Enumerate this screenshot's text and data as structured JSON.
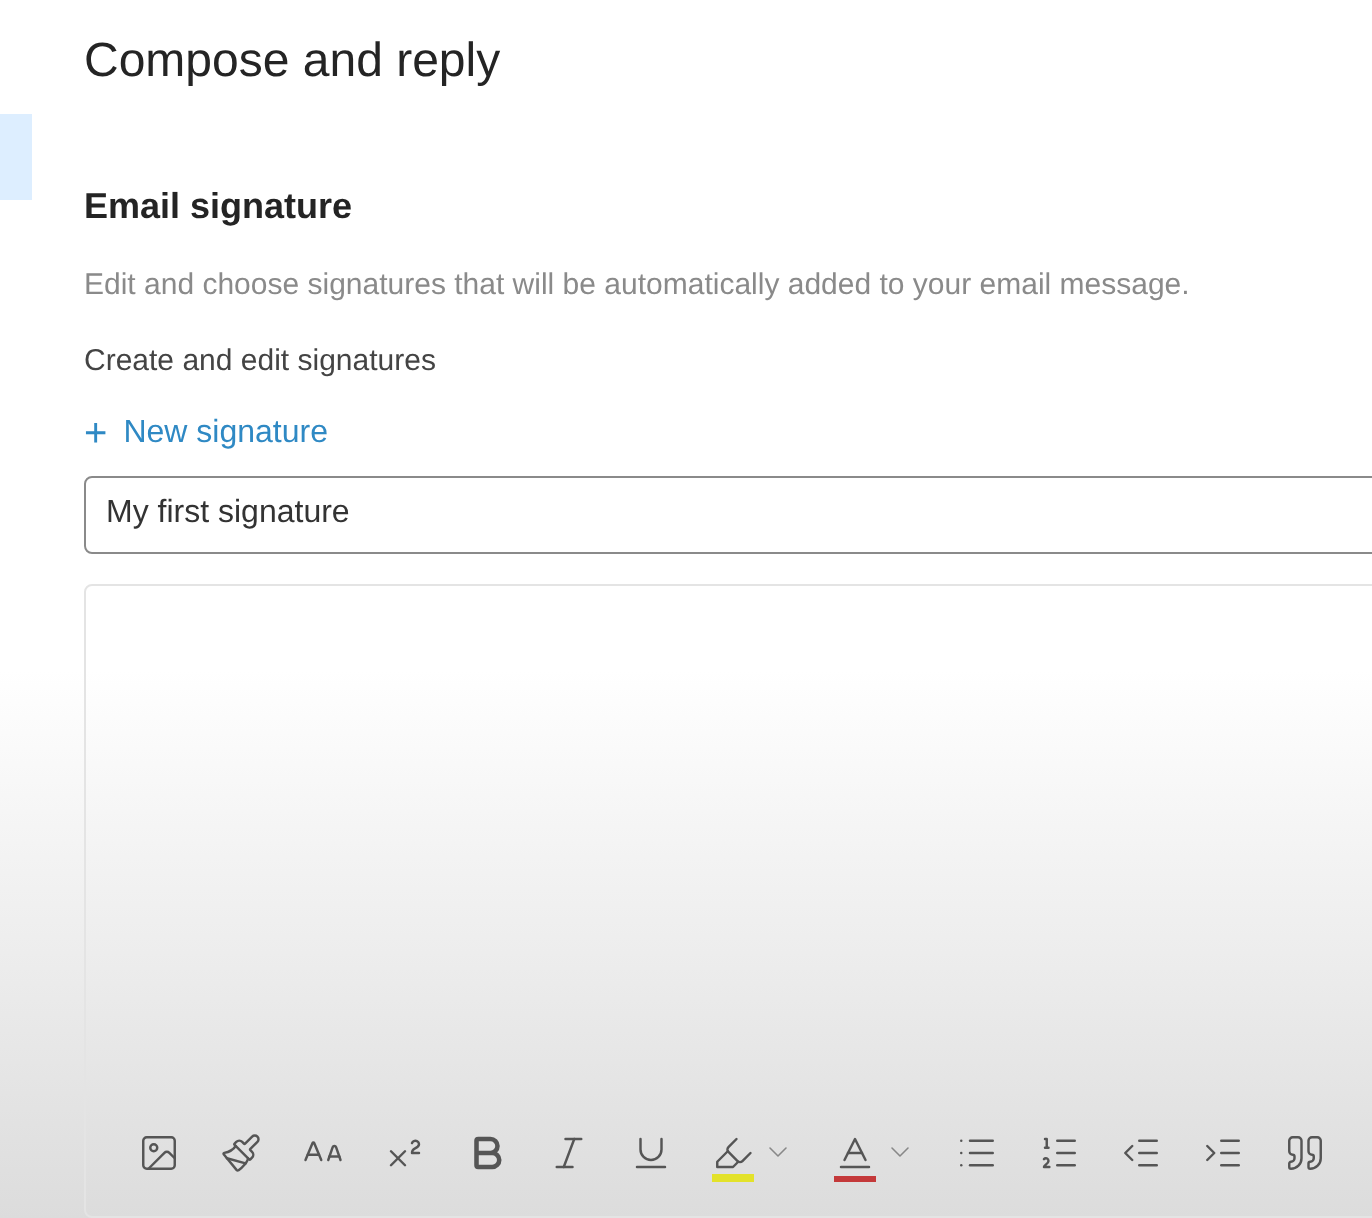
{
  "title": "Compose and reply",
  "section": {
    "heading": "Email signature",
    "description": "Edit and choose signatures that will be automatically added to your email message.",
    "subheading": "Create and edit signatures",
    "new_signature": {
      "icon": "+",
      "label": "New signature"
    },
    "signature_name": {
      "value": "My first signature"
    }
  },
  "toolbar": [
    {
      "kind": "image"
    },
    {
      "kind": "painter"
    },
    {
      "kind": "font-size"
    },
    {
      "kind": "superscript"
    },
    {
      "kind": "bold"
    },
    {
      "kind": "italic"
    },
    {
      "kind": "underline"
    },
    {
      "kind": "highlight",
      "has_menu": true
    },
    {
      "kind": "font-color",
      "has_menu": true
    },
    {
      "kind": "bullets"
    },
    {
      "kind": "numbering"
    },
    {
      "kind": "outdent"
    },
    {
      "kind": "indent"
    },
    {
      "kind": "quote"
    }
  ]
}
